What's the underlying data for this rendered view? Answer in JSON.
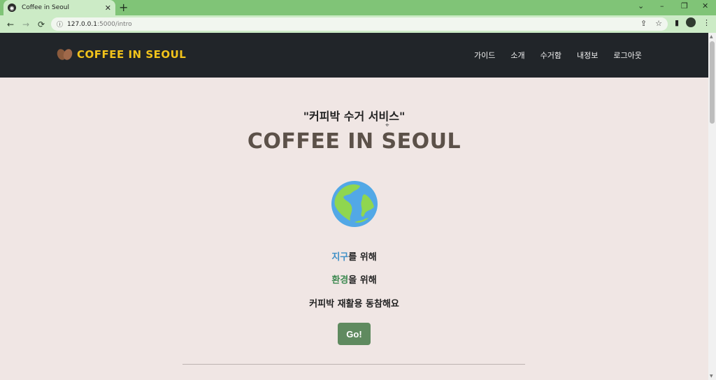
{
  "browser": {
    "tab_title": "Coffee in Seoul",
    "new_tab": "+",
    "url_host": "127.0.0.1",
    "url_rest": ":5000/intro",
    "minimize": "–",
    "restore": "❐",
    "close": "✕",
    "chevron": "⌄"
  },
  "site": {
    "brand": "COFFEE IN SEOUL",
    "nav": [
      "가이드",
      "소개",
      "수거함",
      "내정보",
      "로그아웃"
    ]
  },
  "hero": {
    "subtitle": "\"커피박 수거 서비스\"",
    "title": "COFFEE IN SEOUL",
    "line1_hl": "지구",
    "line1_rest": "를 위해",
    "line2_hl": "환경",
    "line2_rest": "을 위해",
    "line3": "커피박 재활용 동참해요",
    "button": "Go!"
  },
  "colors": {
    "tabbar": "#80c477",
    "navbar": "#212529",
    "brand": "#f2c31b",
    "page_bg": "#f0e6e4",
    "button": "#5f8a5f"
  }
}
